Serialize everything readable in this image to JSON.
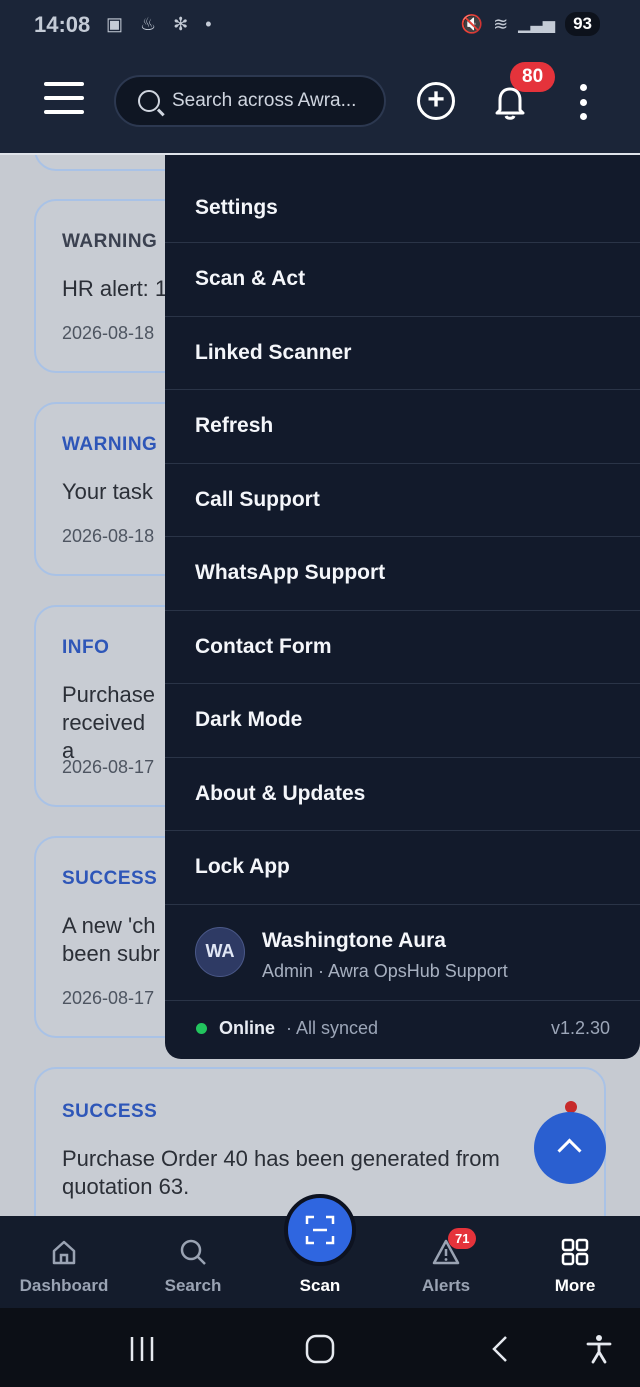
{
  "status_bar": {
    "time": "14:08",
    "battery": "93"
  },
  "header": {
    "search_placeholder": "Search across Awra...",
    "notification_count": "80"
  },
  "notifications": [
    {
      "type": "WARNING",
      "message": "HR alert: 1",
      "date": "2026-08-18"
    },
    {
      "type": "WARNING",
      "message": "Your task",
      "date": "2026-08-18"
    },
    {
      "type": "INFO",
      "message": "Purchase received a",
      "date": "2026-08-17"
    },
    {
      "type": "SUCCESS",
      "message": "A new 'ch been subr",
      "date": "2026-08-17"
    },
    {
      "type": "SUCCESS",
      "message": "Purchase Order 40 has been generated from quotation 63.",
      "date": ""
    }
  ],
  "menu": {
    "items": [
      {
        "label": "Settings"
      },
      {
        "label": "Scan & Act"
      },
      {
        "label": "Linked Scanner"
      },
      {
        "label": "Refresh"
      },
      {
        "label": "Call Support"
      },
      {
        "label": "WhatsApp Support"
      },
      {
        "label": "Contact Form"
      },
      {
        "label": "Dark Mode"
      },
      {
        "label": "About & Updates"
      },
      {
        "label": "Lock App"
      }
    ],
    "profile": {
      "initials": "WA",
      "name": "Washingtone Aura",
      "role": "Admin · Awra OpsHub Support"
    },
    "status": {
      "online": "Online",
      "sync": "· All synced",
      "version": "v1.2.30"
    }
  },
  "bottom_nav": {
    "items": [
      {
        "label": "Dashboard"
      },
      {
        "label": "Search"
      },
      {
        "label": "Scan"
      },
      {
        "label": "Alerts",
        "badge": "71"
      },
      {
        "label": "More"
      }
    ]
  },
  "colors": {
    "accent": "#2f66e0",
    "badge": "#e5333b",
    "online": "#22c55e",
    "menu_bg": "#121a2b"
  }
}
